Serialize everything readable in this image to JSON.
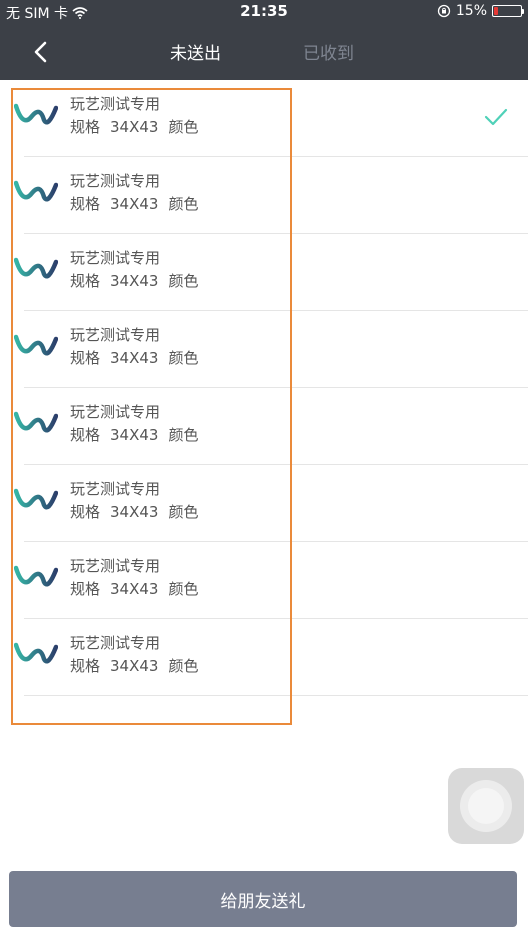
{
  "status_bar": {
    "carrier": "无 SIM 卡",
    "time": "21:35",
    "battery": "15%"
  },
  "nav": {
    "tab_active": "未送出",
    "tab_inactive": "已收到"
  },
  "items": [
    {
      "title": "玩艺测试专用",
      "spec_label": "规格",
      "spec_value": "34X43",
      "color_label": "颜色",
      "selected": true
    },
    {
      "title": "玩艺测试专用",
      "spec_label": "规格",
      "spec_value": "34X43",
      "color_label": "颜色",
      "selected": false
    },
    {
      "title": "玩艺测试专用",
      "spec_label": "规格",
      "spec_value": "34X43",
      "color_label": "颜色",
      "selected": false
    },
    {
      "title": "玩艺测试专用",
      "spec_label": "规格",
      "spec_value": "34X43",
      "color_label": "颜色",
      "selected": false
    },
    {
      "title": "玩艺测试专用",
      "spec_label": "规格",
      "spec_value": "34X43",
      "color_label": "颜色",
      "selected": false
    },
    {
      "title": "玩艺测试专用",
      "spec_label": "规格",
      "spec_value": "34X43",
      "color_label": "颜色",
      "selected": false
    },
    {
      "title": "玩艺测试专用",
      "spec_label": "规格",
      "spec_value": "34X43",
      "color_label": "颜色",
      "selected": false
    },
    {
      "title": "玩艺测试专用",
      "spec_label": "规格",
      "spec_value": "34X43",
      "color_label": "颜色",
      "selected": false
    }
  ],
  "footer": {
    "gift_button_label": "给朋友送礼"
  },
  "colors": {
    "nav_bg": "#3c4047",
    "check": "#4fd1b8",
    "button_bg": "#777e90",
    "highlight": "#ea8a3a"
  }
}
